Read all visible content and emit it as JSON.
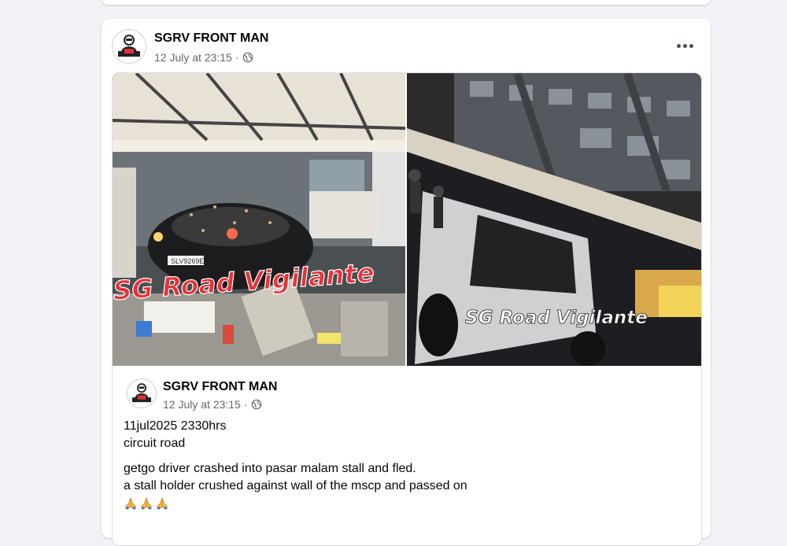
{
  "post": {
    "author": "SGRV FRONT MAN",
    "date": "12 July at 23:15",
    "separator": "·",
    "privacy_icon": "globe-icon",
    "more_icon": "more-options-icon"
  },
  "photos": [
    {
      "watermark": "SG Road Vigilante",
      "plate": "SLV9269E"
    },
    {
      "watermark": "SG Road Vigilante"
    }
  ],
  "shared_post": {
    "author": "SGRV FRONT MAN",
    "date": "12 July at 23:15",
    "separator": "·",
    "lines": [
      "11jul2025 2330hrs",
      "circuit road",
      "getgo driver crashed into pasar malam stall and fled.",
      "a stall holder crushed against wall of the mscp and passed on"
    ],
    "emoji": [
      "folded-hands-icon",
      "folded-hands-icon",
      "folded-hands-icon"
    ]
  },
  "colors": {
    "watermark_red": "#e8323a",
    "meta_grey": "#65676b",
    "background": "#f0f2f5"
  }
}
